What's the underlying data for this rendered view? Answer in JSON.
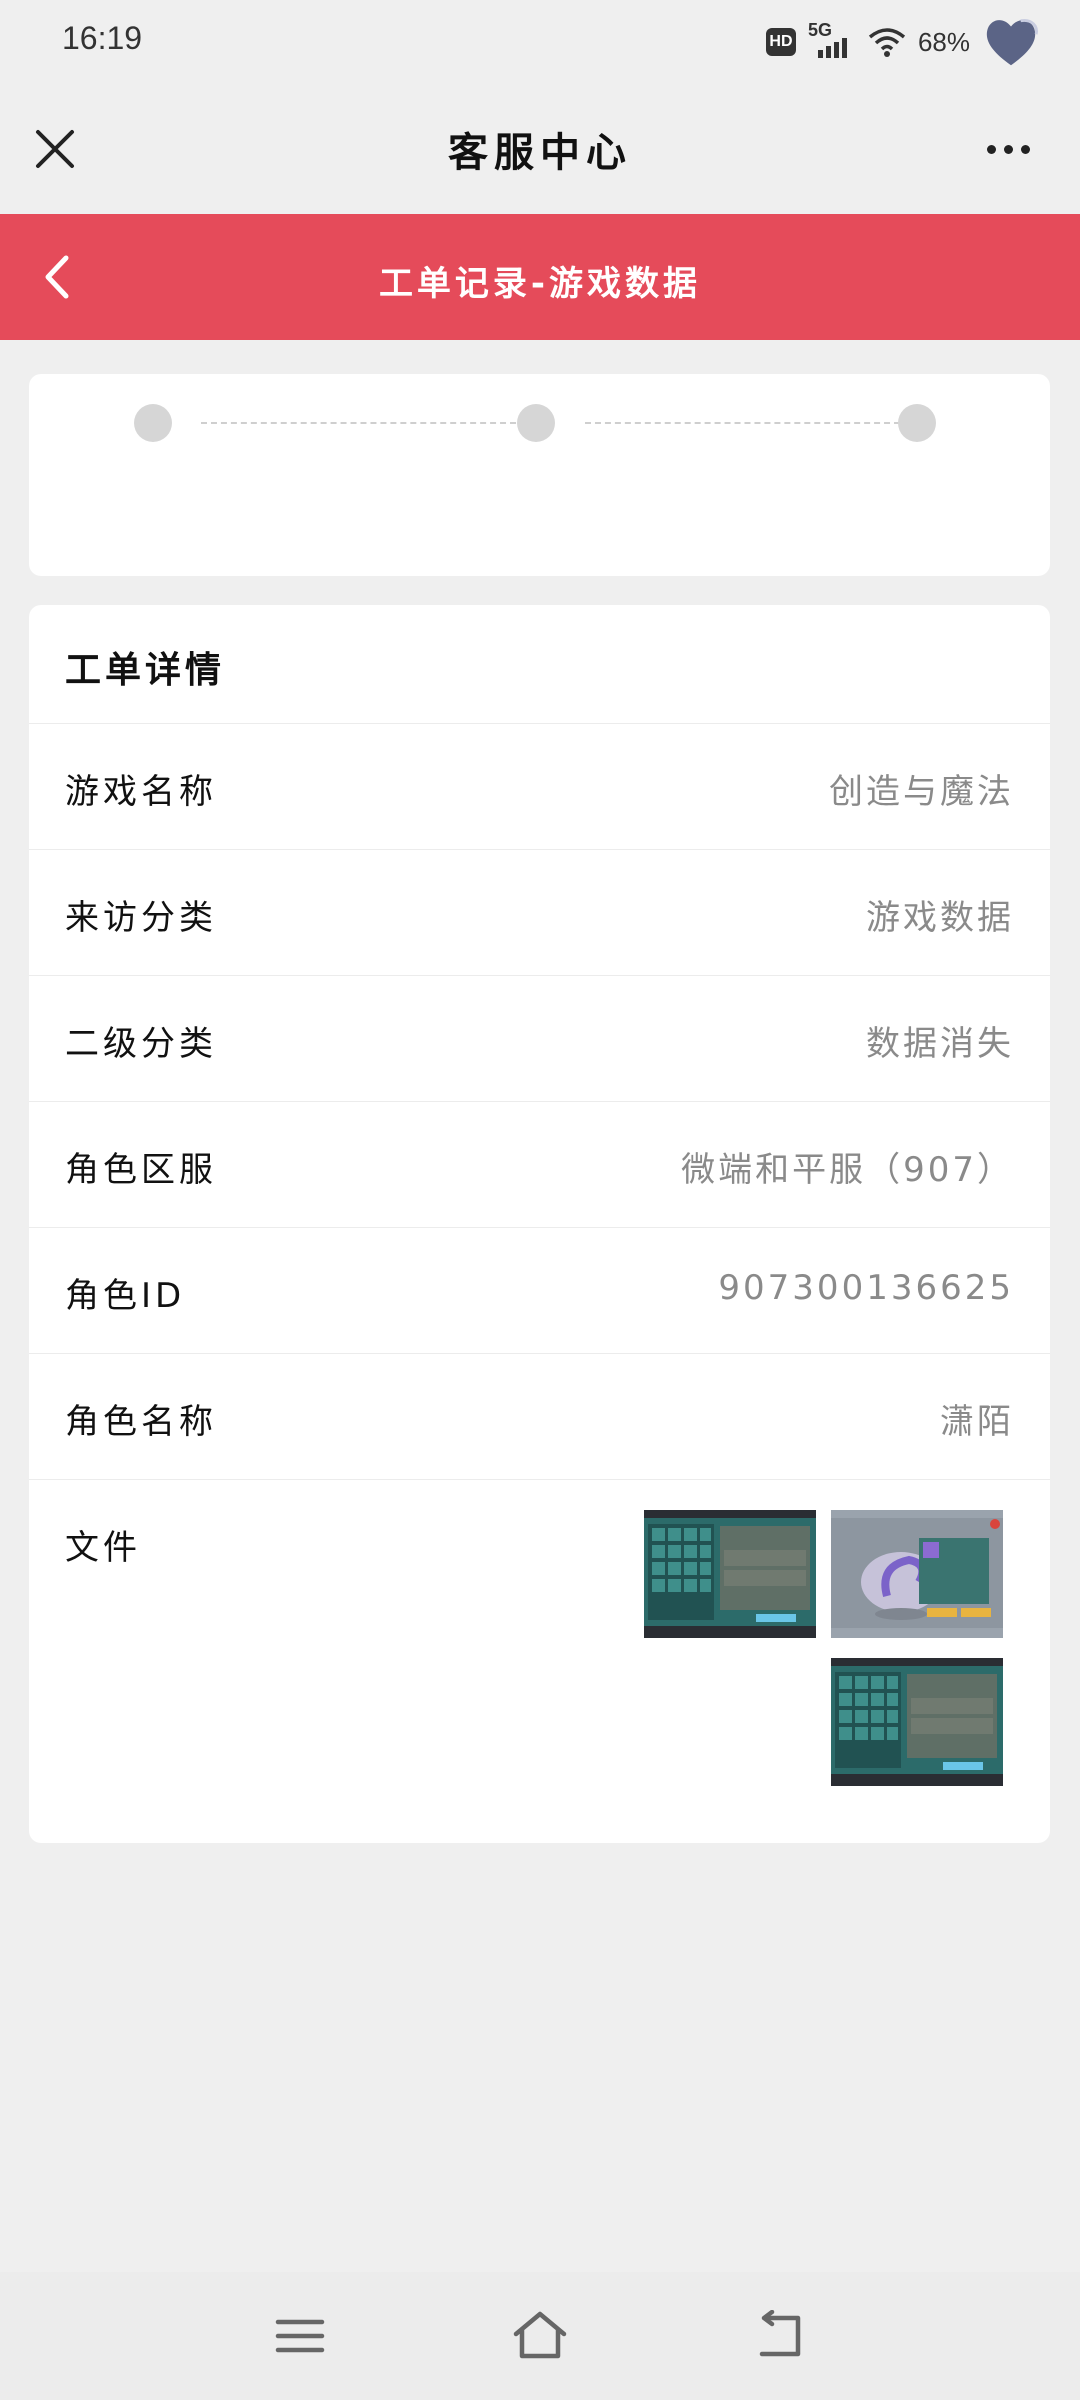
{
  "status_bar": {
    "time": "16:19",
    "hd": "HD",
    "network": "5G",
    "battery": "68%"
  },
  "titlebar": {
    "title": "客服中心",
    "icons": [
      "close-icon",
      "more-icon"
    ]
  },
  "header": {
    "title": "工单记录-游戏数据",
    "icons": [
      "back-chevron-icon"
    ]
  },
  "progress": {
    "steps": 3,
    "step_color": "#d6d6d6"
  },
  "detail": {
    "section_title": "工单详情",
    "rows": [
      {
        "label": "游戏名称",
        "value": "创造与魔法"
      },
      {
        "label": "来访分类",
        "value": "游戏数据"
      },
      {
        "label": "二级分类",
        "value": "数据消失"
      },
      {
        "label": "角色区服",
        "value": "微端和平服（907）"
      },
      {
        "label": "角色ID",
        "value": "907300136625"
      },
      {
        "label": "角色名称",
        "value": "潇陌"
      }
    ],
    "file_label": "文件",
    "files": [
      "game-screenshot-1",
      "game-screenshot-2",
      "game-screenshot-3"
    ]
  },
  "nav_bar": {
    "icons": [
      "menu-icon",
      "home-icon",
      "back-icon"
    ]
  },
  "colors": {
    "accent": "#e54b5a",
    "background": "#efefef",
    "value_text": "#8a8a8a"
  }
}
